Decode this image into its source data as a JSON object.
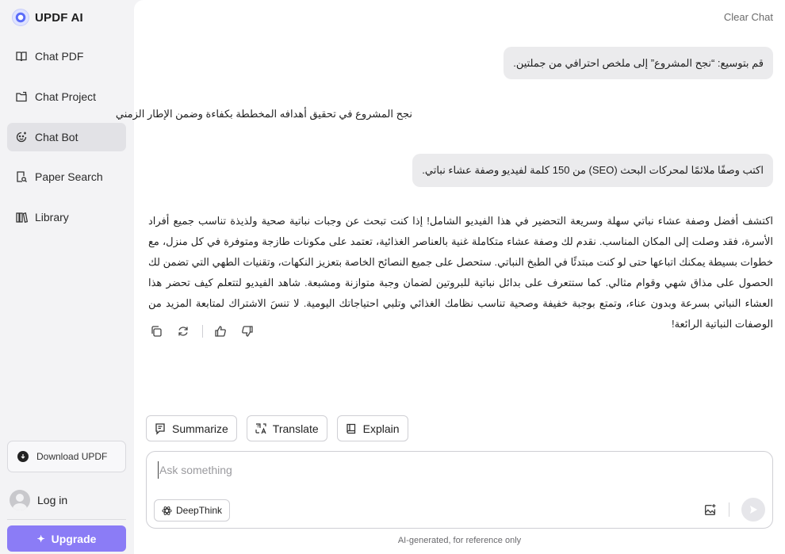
{
  "brand": {
    "name": "UPDF AI"
  },
  "sidebar": {
    "items": [
      {
        "label": "Chat PDF",
        "icon": "book-open-icon"
      },
      {
        "label": "Chat Project",
        "icon": "folder-icon"
      },
      {
        "label": "Chat Bot",
        "icon": "bot-face-icon",
        "active": true
      },
      {
        "label": "Paper Search",
        "icon": "document-search-icon"
      },
      {
        "label": "Library",
        "icon": "library-icon"
      }
    ],
    "download_label": "Download UPDF",
    "login_label": "Log in",
    "upgrade_label": "Upgrade"
  },
  "header": {
    "clear_chat": "Clear Chat"
  },
  "conversation": {
    "user_1": "قم بتوسيع: “نجح المشروع” إلى ملخص احترافي من جملتين.",
    "assistant_1": "نجح المشروع في تحقيق أهدافه المخططة بكفاءة وضمن الإطار الزمني",
    "user_2": "اكتب وصفًا ملائمًا لمحركات البحث (SEO) من 150 كلمة لفيديو وصفة عشاء نباتي.",
    "assistant_2": "اكتشف أفضل وصفة عشاء نباتي سهلة وسريعة التحضير في هذا الفيديو الشامل! إذا كنت تبحث عن وجبات نباتية صحية ولذيذة تناسب جميع أفراد الأسرة، فقد وصلت إلى المكان المناسب. نقدم لك وصفة عشاء متكاملة غنية بالعناصر الغذائية، تعتمد على مكونات طازجة ومتوفرة في كل منزل، مع خطوات بسيطة يمكنك اتباعها حتى لو كنت مبتدئًا في الطبخ النباتي. ستحصل على جميع النصائح الخاصة بتعزيز النكهات، وتقنيات الطهي التي تضمن لك الحصول على مذاق شهي وقوام مثالي. كما ستتعرف على بدائل نباتية للبروتين لضمان وجبة متوازنة ومشبعة. شاهد الفيديو لتتعلم كيف تحضر هذا العشاء النباتي بسرعة وبدون عناء، وتمتع بوجبة خفيفة وصحية تناسب نظامك الغذائي وتلبي احتياجاتك اليومية. لا تنسَ الاشتراك لمتابعة المزيد من الوصفات النباتية الرائعة!"
  },
  "quick_actions": [
    {
      "label": "Summarize",
      "icon": "summarize-icon"
    },
    {
      "label": "Translate",
      "icon": "translate-icon"
    },
    {
      "label": "Explain",
      "icon": "book-icon"
    }
  ],
  "composer": {
    "placeholder": "Ask something",
    "deepthink_label": "DeepThink"
  },
  "footer": {
    "note": "AI-generated, for reference only"
  },
  "colors": {
    "accent": "#8b7cf6",
    "active_nav": "#e2e2e6",
    "bubble": "#ebebed"
  }
}
